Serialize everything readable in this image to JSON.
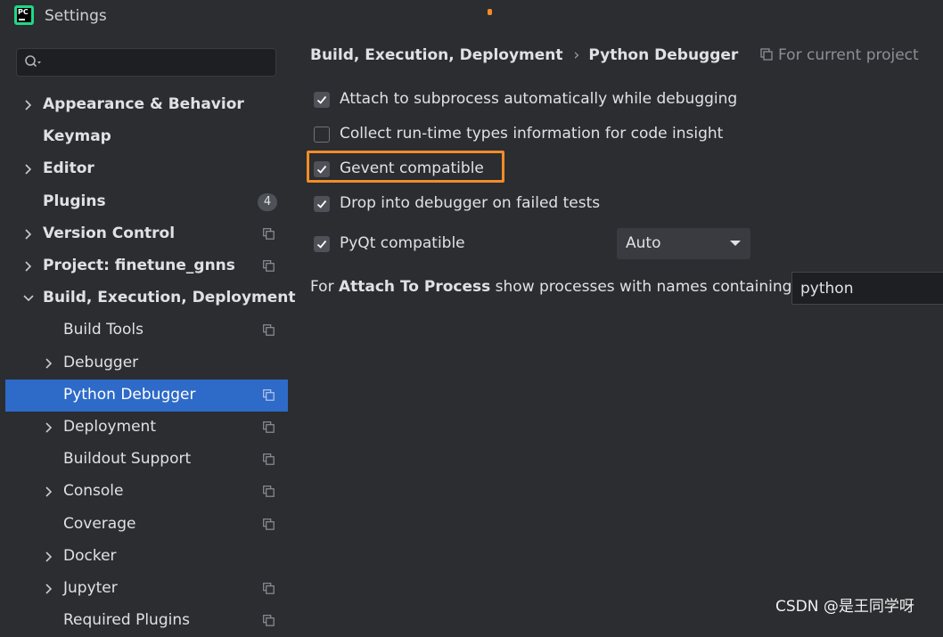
{
  "window": {
    "title": "Settings",
    "app_icon_text": "PC"
  },
  "search": {
    "placeholder": ""
  },
  "sidebar": {
    "items": [
      {
        "label": "Appearance & Behavior",
        "level": 0,
        "expandable": true,
        "expanded": false,
        "bold": true,
        "project_icon": false,
        "badge": ""
      },
      {
        "label": "Keymap",
        "level": 0,
        "expandable": false,
        "expanded": false,
        "bold": true,
        "project_icon": false,
        "badge": ""
      },
      {
        "label": "Editor",
        "level": 0,
        "expandable": true,
        "expanded": false,
        "bold": true,
        "project_icon": false,
        "badge": ""
      },
      {
        "label": "Plugins",
        "level": 0,
        "expandable": false,
        "expanded": false,
        "bold": true,
        "project_icon": false,
        "badge": "4"
      },
      {
        "label": "Version Control",
        "level": 0,
        "expandable": true,
        "expanded": false,
        "bold": true,
        "project_icon": true,
        "badge": ""
      },
      {
        "label": "Project: finetune_gnns",
        "level": 0,
        "expandable": true,
        "expanded": false,
        "bold": true,
        "project_icon": true,
        "badge": ""
      },
      {
        "label": "Build, Execution, Deployment",
        "level": 0,
        "expandable": true,
        "expanded": true,
        "bold": true,
        "project_icon": false,
        "badge": ""
      },
      {
        "label": "Build Tools",
        "level": 1,
        "expandable": false,
        "expanded": false,
        "bold": false,
        "project_icon": true,
        "badge": ""
      },
      {
        "label": "Debugger",
        "level": 1,
        "expandable": true,
        "expanded": false,
        "bold": false,
        "project_icon": false,
        "badge": ""
      },
      {
        "label": "Python Debugger",
        "level": 1,
        "expandable": false,
        "expanded": false,
        "bold": false,
        "project_icon": true,
        "badge": "",
        "selected": true
      },
      {
        "label": "Deployment",
        "level": 1,
        "expandable": true,
        "expanded": false,
        "bold": false,
        "project_icon": true,
        "badge": ""
      },
      {
        "label": "Buildout Support",
        "level": 1,
        "expandable": false,
        "expanded": false,
        "bold": false,
        "project_icon": true,
        "badge": ""
      },
      {
        "label": "Console",
        "level": 1,
        "expandable": true,
        "expanded": false,
        "bold": false,
        "project_icon": true,
        "badge": ""
      },
      {
        "label": "Coverage",
        "level": 1,
        "expandable": false,
        "expanded": false,
        "bold": false,
        "project_icon": true,
        "badge": ""
      },
      {
        "label": "Docker",
        "level": 1,
        "expandable": true,
        "expanded": false,
        "bold": false,
        "project_icon": false,
        "badge": ""
      },
      {
        "label": "Jupyter",
        "level": 1,
        "expandable": true,
        "expanded": false,
        "bold": false,
        "project_icon": true,
        "badge": ""
      },
      {
        "label": "Required Plugins",
        "level": 1,
        "expandable": false,
        "expanded": false,
        "bold": false,
        "project_icon": true,
        "badge": ""
      }
    ]
  },
  "header": {
    "breadcrumb_parent": "Build, Execution, Deployment",
    "breadcrumb_separator": "›",
    "breadcrumb_current": "Python Debugger",
    "scope_label": "For current project"
  },
  "options": [
    {
      "label": "Attach to subprocess automatically while debugging",
      "checked": true
    },
    {
      "label": "Collect run-time types information for code insight",
      "checked": false
    },
    {
      "label": "Gevent compatible",
      "checked": true,
      "highlighted": true
    },
    {
      "label": "Drop into debugger on failed tests",
      "checked": true
    },
    {
      "label": "PyQt compatible",
      "checked": true
    }
  ],
  "pyqt_select": {
    "value": "Auto"
  },
  "attach_to_process": {
    "prefix": "For",
    "bold": "Attach To Process",
    "suffix": "show processes with names containing:",
    "value": "python"
  },
  "watermark": "CSDN @是王同学呀",
  "colors": {
    "accent_selection": "#2e6ac8",
    "highlight_border": "#f28c28",
    "background": "#2b2d30"
  }
}
